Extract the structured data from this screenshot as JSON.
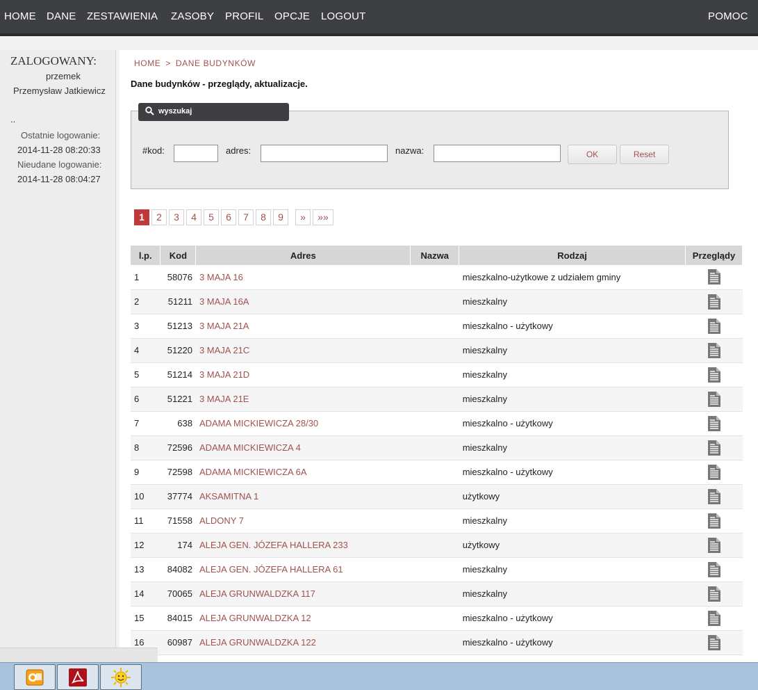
{
  "nav": {
    "items": [
      "HOME",
      "DANE",
      "ZESTAWIENIA",
      "ZASOBY",
      "PROFIL",
      "OPCJE",
      "LOGOUT"
    ],
    "help": "POMOC"
  },
  "sidebar": {
    "logged_label": "ZALOGOWANY:",
    "username": "przemek",
    "fullname": "Przemysław Jatkiewicz",
    "dots": "..",
    "last_login_label": "Ostatnie logowanie:",
    "last_login": "2014-11-28 08:20:33",
    "failed_login_label": "Nieudane logowanie:",
    "failed_login": "2014-11-28 08:04:27"
  },
  "breadcrumb": [
    "HOME",
    "DANE BUDYNKÓW"
  ],
  "breadcrumb_sep": ">",
  "page_title": "Dane budynków - przeglądy, aktualizacje.",
  "search": {
    "tab_label": "wyszukaj",
    "kod_label": "#kod:",
    "adres_label": "adres:",
    "nazwa_label": "nazwa:",
    "kod_value": "",
    "adres_value": "",
    "nazwa_value": "",
    "ok_label": "OK",
    "reset_label": "Reset"
  },
  "pager": {
    "pages": [
      "1",
      "2",
      "3",
      "4",
      "5",
      "6",
      "7",
      "8",
      "9"
    ],
    "current": "1",
    "next": "»",
    "last": "»»"
  },
  "table": {
    "headers": [
      "l.p.",
      "Kod",
      "Adres",
      "Nazwa",
      "Rodzaj",
      "Przeglądy"
    ],
    "rows": [
      {
        "lp": "1",
        "kod": "58076",
        "adres": "3 MAJA 16",
        "nazwa": "",
        "rodzaj": "mieszkalno-użytkowe z udziałem gminy"
      },
      {
        "lp": "2",
        "kod": "51211",
        "adres": "3 MAJA 16A",
        "nazwa": "",
        "rodzaj": "mieszkalny"
      },
      {
        "lp": "3",
        "kod": "51213",
        "adres": "3 MAJA 21A",
        "nazwa": "",
        "rodzaj": "mieszkalno - użytkowy"
      },
      {
        "lp": "4",
        "kod": "51220",
        "adres": "3 MAJA 21C",
        "nazwa": "",
        "rodzaj": "mieszkalny"
      },
      {
        "lp": "5",
        "kod": "51214",
        "adres": "3 MAJA 21D",
        "nazwa": "",
        "rodzaj": "mieszkalny"
      },
      {
        "lp": "6",
        "kod": "51221",
        "adres": "3 MAJA 21E",
        "nazwa": "",
        "rodzaj": "mieszkalny"
      },
      {
        "lp": "7",
        "kod": "638",
        "adres": "ADAMA MICKIEWICZA 28/30",
        "nazwa": "",
        "rodzaj": "mieszkalno - użytkowy"
      },
      {
        "lp": "8",
        "kod": "72596",
        "adres": "ADAMA MICKIEWICZA 4",
        "nazwa": "",
        "rodzaj": "mieszkalny"
      },
      {
        "lp": "9",
        "kod": "72598",
        "adres": "ADAMA MICKIEWICZA 6A",
        "nazwa": "",
        "rodzaj": "mieszkalno - użytkowy"
      },
      {
        "lp": "10",
        "kod": "37774",
        "adres": "AKSAMITNA 1",
        "nazwa": "",
        "rodzaj": "użytkowy"
      },
      {
        "lp": "11",
        "kod": "71558",
        "adres": "ALDONY 7",
        "nazwa": "",
        "rodzaj": "mieszkalny"
      },
      {
        "lp": "12",
        "kod": "174",
        "adres": "ALEJA GEN. JÓZEFA HALLERA 233",
        "nazwa": "",
        "rodzaj": "użytkowy"
      },
      {
        "lp": "13",
        "kod": "84082",
        "adres": "ALEJA GEN. JÓZEFA HALLERA 61",
        "nazwa": "",
        "rodzaj": "mieszkalny"
      },
      {
        "lp": "14",
        "kod": "70065",
        "adres": "ALEJA GRUNWALDZKA 117",
        "nazwa": "",
        "rodzaj": "mieszkalny"
      },
      {
        "lp": "15",
        "kod": "84015",
        "adres": "ALEJA GRUNWALDZKA 12",
        "nazwa": "",
        "rodzaj": "mieszkalno - użytkowy"
      },
      {
        "lp": "16",
        "kod": "60987",
        "adres": "ALEJA GRUNWALDZKA 122",
        "nazwa": "",
        "rodzaj": "mieszkalno - użytkowy"
      }
    ],
    "review_icon": "document-icon"
  },
  "taskbar": {
    "apps": [
      "outlook-icon",
      "acrobat-icon",
      "sun-icon"
    ]
  },
  "colors": {
    "nav_bg": "#3d3f42",
    "link": "#a0524f",
    "active_page": "#c0393b",
    "taskbar": "#a9c3dc"
  }
}
